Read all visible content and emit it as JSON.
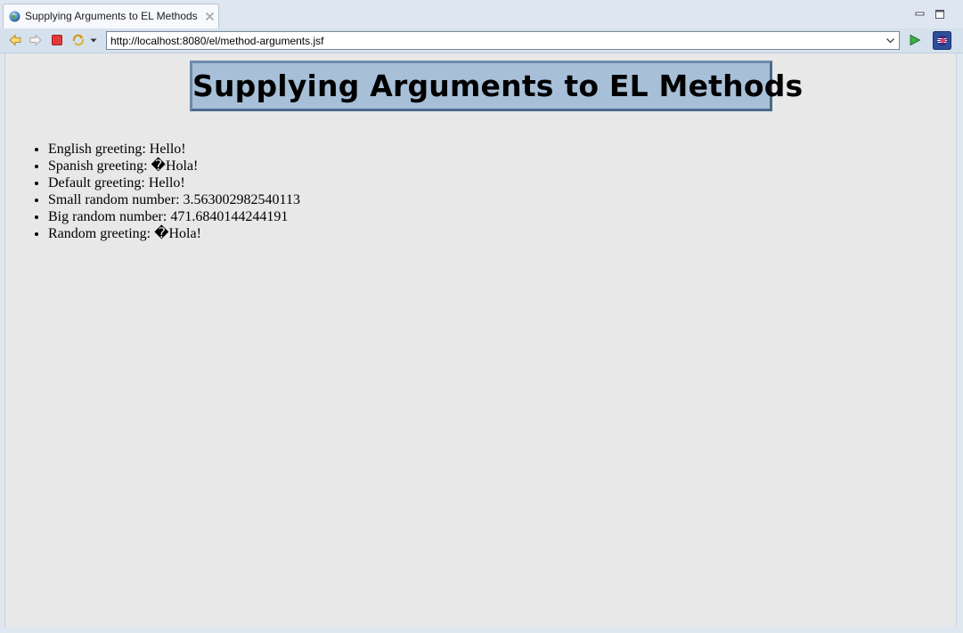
{
  "tab": {
    "title": "Supplying Arguments to EL Methods"
  },
  "toolbar": {
    "url": "http://localhost:8080/el/method-arguments.jsf"
  },
  "page": {
    "heading": "Supplying Arguments to EL Methods",
    "items": [
      "English greeting: Hello!",
      "Spanish greeting: �Hola!",
      "Default greeting: Hello!",
      "Small random number: 3.563002982540113",
      "Big random number: 471.6840144244191",
      "Random greeting: �Hola!"
    ]
  },
  "colors": {
    "heading_bg": "#a8bfd8",
    "heading_border": "#4b6a8c",
    "content_bg": "#e8e8e8"
  }
}
